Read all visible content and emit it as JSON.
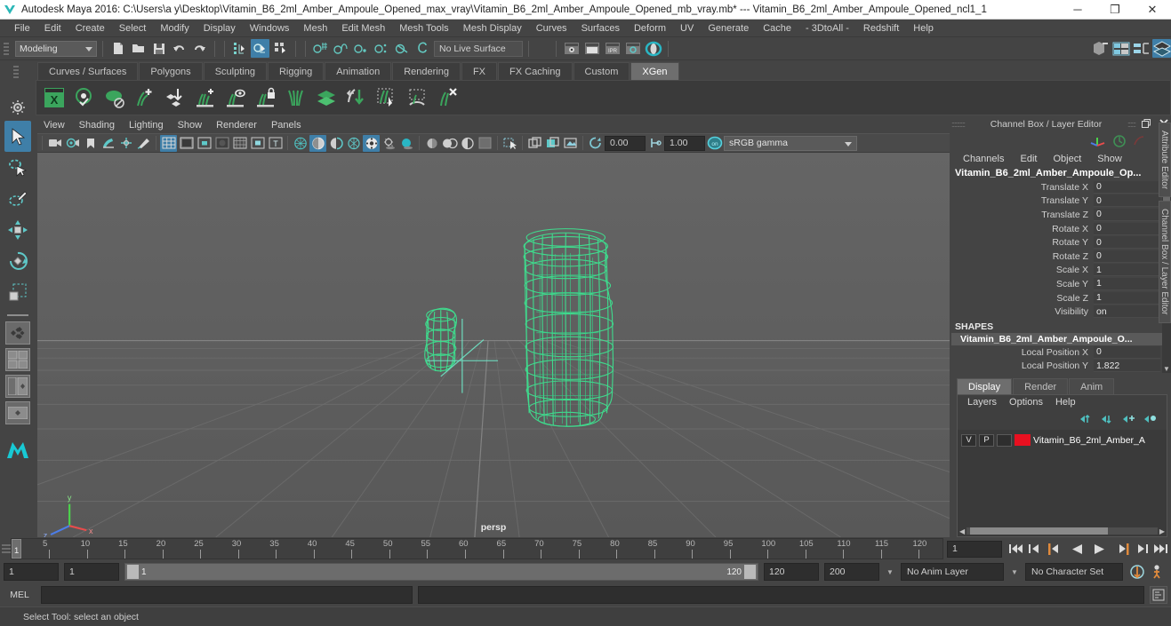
{
  "titlebar": {
    "app_title": "Autodesk Maya 2016: C:\\Users\\a y\\Desktop\\Vitamin_B6_2ml_Amber_Ampoule_Opened_max_vray\\Vitamin_B6_2ml_Amber_Ampoule_Opened_mb_vray.mb*  ---  Vitamin_B6_2ml_Amber_Ampoule_Opened_ncl1_1",
    "minimize": "─",
    "maximize": "❐",
    "close": "✕"
  },
  "menubar": {
    "items": [
      {
        "label": "File"
      },
      {
        "label": "Edit"
      },
      {
        "label": "Create"
      },
      {
        "label": "Select"
      },
      {
        "label": "Modify"
      },
      {
        "label": "Display"
      },
      {
        "label": "Windows"
      },
      {
        "label": "Mesh"
      },
      {
        "label": "Edit Mesh"
      },
      {
        "label": "Mesh Tools"
      },
      {
        "label": "Mesh Display"
      },
      {
        "label": "Curves"
      },
      {
        "label": "Surfaces"
      },
      {
        "label": "Deform"
      },
      {
        "label": "UV"
      },
      {
        "label": "Generate"
      },
      {
        "label": "Cache"
      },
      {
        "label": "- 3DtoAll -"
      },
      {
        "label": "Redshift"
      },
      {
        "label": "Help"
      }
    ]
  },
  "statusline": {
    "menuset": "Modeling",
    "live_surface": "No Live Surface"
  },
  "shelf": {
    "tabs": [
      {
        "label": "Curves / Surfaces",
        "active": false
      },
      {
        "label": "Polygons",
        "active": false
      },
      {
        "label": "Sculpting",
        "active": false
      },
      {
        "label": "Rigging",
        "active": false
      },
      {
        "label": "Animation",
        "active": false
      },
      {
        "label": "Rendering",
        "active": false
      },
      {
        "label": "FX",
        "active": false
      },
      {
        "label": "FX Caching",
        "active": false
      },
      {
        "label": "Custom",
        "active": false
      },
      {
        "label": "XGen",
        "active": true
      }
    ]
  },
  "viewport": {
    "menu": [
      {
        "label": "View"
      },
      {
        "label": "Shading"
      },
      {
        "label": "Lighting"
      },
      {
        "label": "Show"
      },
      {
        "label": "Renderer"
      },
      {
        "label": "Panels"
      }
    ],
    "exposure": "0.00",
    "gamma_value": "1.00",
    "color_profile": "sRGB gamma",
    "camera_label": "persp",
    "bg_color": "#5d5d5d",
    "wireframe_color": "#3ee08f"
  },
  "channel_box": {
    "panel_title": "Channel Box / Layer Editor",
    "menu": [
      {
        "label": "Channels"
      },
      {
        "label": "Edit"
      },
      {
        "label": "Object"
      },
      {
        "label": "Show"
      }
    ],
    "object_name": "Vitamin_B6_2ml_Amber_Ampoule_Op...",
    "attributes": [
      {
        "label": "Translate X",
        "value": "0"
      },
      {
        "label": "Translate Y",
        "value": "0"
      },
      {
        "label": "Translate Z",
        "value": "0"
      },
      {
        "label": "Rotate X",
        "value": "0"
      },
      {
        "label": "Rotate Y",
        "value": "0"
      },
      {
        "label": "Rotate Z",
        "value": "0"
      },
      {
        "label": "Scale X",
        "value": "1"
      },
      {
        "label": "Scale Y",
        "value": "1"
      },
      {
        "label": "Scale Z",
        "value": "1"
      },
      {
        "label": "Visibility",
        "value": "on"
      }
    ],
    "shapes_header": "SHAPES",
    "shape_name": "Vitamin_B6_2ml_Amber_Ampoule_O...",
    "shape_attributes": [
      {
        "label": "Local Position X",
        "value": "0"
      },
      {
        "label": "Local Position Y",
        "value": "1.822"
      }
    ]
  },
  "layer_editor": {
    "tabs": [
      {
        "label": "Display",
        "active": true
      },
      {
        "label": "Render",
        "active": false
      },
      {
        "label": "Anim",
        "active": false
      }
    ],
    "menu": [
      {
        "label": "Layers"
      },
      {
        "label": "Options"
      },
      {
        "label": "Help"
      }
    ],
    "layers": [
      {
        "visibility": "V",
        "playback": "P",
        "shading": "",
        "color": "#e81020",
        "name": "Vitamin_B6_2ml_Amber_A"
      }
    ]
  },
  "vertical_tabs": [
    {
      "label": "Attribute Editor"
    },
    {
      "label": "Channel Box / Layer Editor"
    }
  ],
  "time_slider": {
    "ticks": [
      5,
      10,
      15,
      20,
      25,
      30,
      35,
      40,
      45,
      50,
      55,
      60,
      65,
      70,
      75,
      80,
      85,
      90,
      95,
      100,
      105,
      110,
      115,
      120
    ],
    "current_frame": "1",
    "playhead_label": "1",
    "frame_field": "1"
  },
  "playback": {
    "buttons": [
      {
        "name": "go-to-start",
        "glyph": "⏮"
      },
      {
        "name": "step-back-key",
        "glyph": "⏴"
      },
      {
        "name": "step-back-frame",
        "glyph": "◀"
      },
      {
        "name": "play-backwards",
        "glyph": "◀"
      },
      {
        "name": "play-forwards",
        "glyph": "▶"
      },
      {
        "name": "step-forward-frame",
        "glyph": "▶"
      },
      {
        "name": "step-forward-key",
        "glyph": "⏵"
      },
      {
        "name": "go-to-end",
        "glyph": "⏭"
      }
    ]
  },
  "range_slider": {
    "anim_start": "1",
    "range_start": "1",
    "range_bar_start": "1",
    "range_bar_end": "120",
    "range_end": "120",
    "anim_end": "200",
    "anim_layer": "No Anim Layer",
    "character_set": "No Character Set"
  },
  "command_line": {
    "language": "MEL",
    "input_value": "",
    "output_value": ""
  },
  "statusbar": {
    "help_text": "Select Tool: select an object"
  }
}
